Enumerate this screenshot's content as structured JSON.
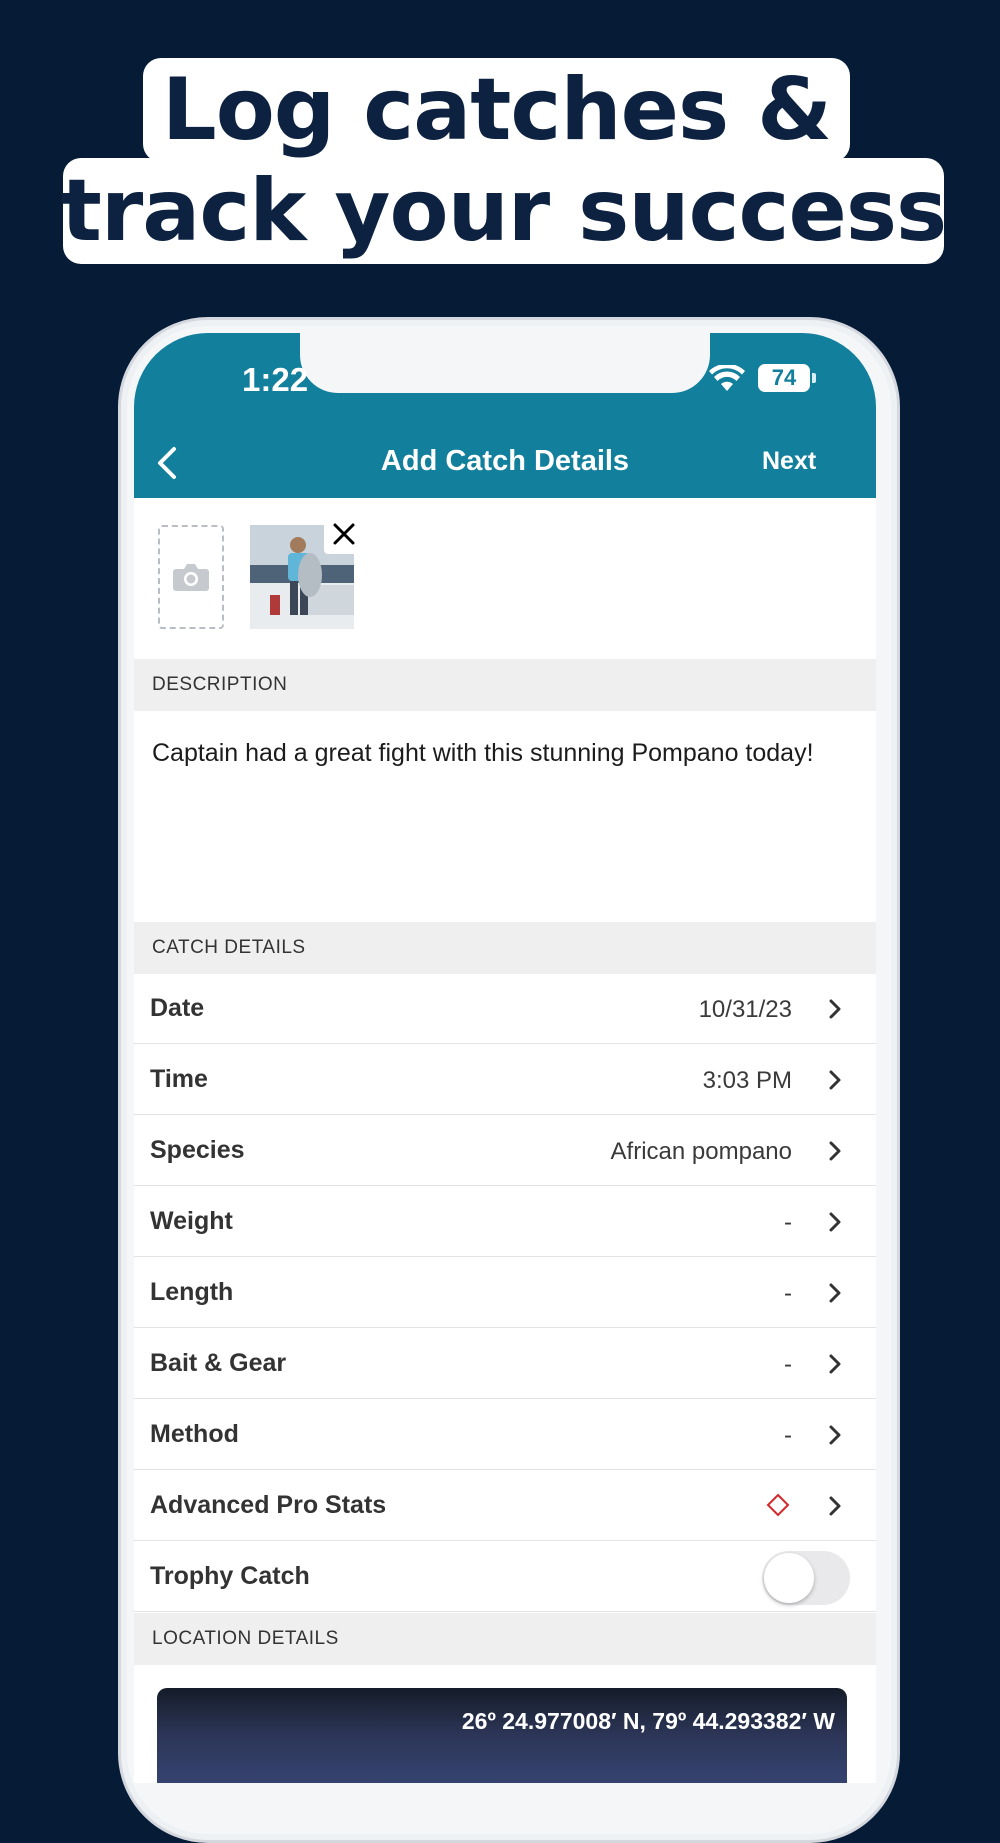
{
  "headline": {
    "line1": "Log catches &",
    "line2": "track your success"
  },
  "status_bar": {
    "time": "1:22",
    "battery": "74"
  },
  "nav": {
    "title": "Add Catch Details",
    "next_label": "Next"
  },
  "description": {
    "header": "DESCRIPTION",
    "text": "Captain had a great fight with this stunning Pompano today!"
  },
  "catch_details": {
    "header": "CATCH DETAILS",
    "rows": [
      {
        "label": "Date",
        "value": "10/31/23"
      },
      {
        "label": "Time",
        "value": "3:03 PM"
      },
      {
        "label": "Species",
        "value": "African pompano"
      },
      {
        "label": "Weight",
        "value": "-"
      },
      {
        "label": "Length",
        "value": "-"
      },
      {
        "label": "Bait & Gear",
        "value": "-"
      },
      {
        "label": "Method",
        "value": "-"
      },
      {
        "label": "Advanced Pro Stats",
        "icon": "pro-diamond-icon"
      },
      {
        "label": "Trophy Catch",
        "toggle": false
      }
    ]
  },
  "location": {
    "header": "LOCATION DETAILS",
    "coordinates": "26º 24.977008′ N, 79º 44.293382′ W"
  },
  "colors": {
    "background": "#061c36",
    "brand": "#127f9c",
    "pro_accent": "#d6282a"
  }
}
